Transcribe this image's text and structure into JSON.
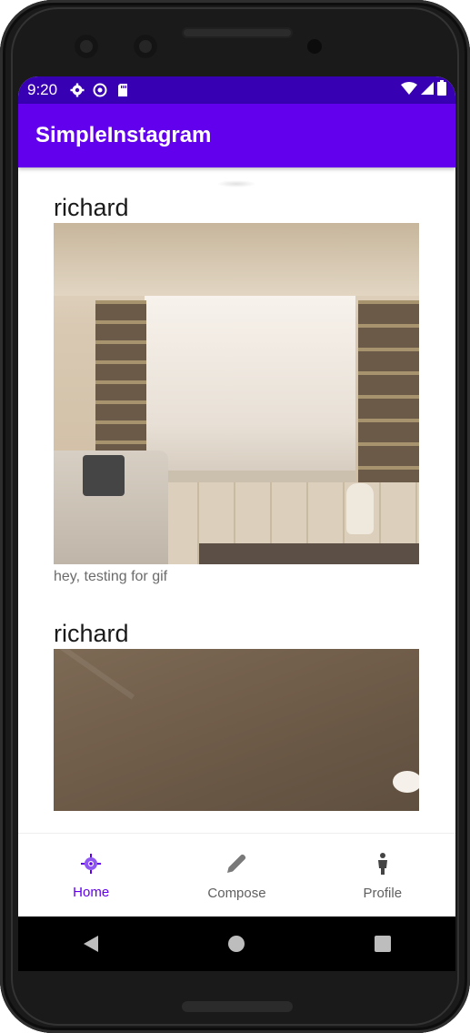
{
  "status_bar": {
    "time": "9:20",
    "icons": [
      "settings-gear-icon",
      "at-sign-icon",
      "sd-card-icon"
    ],
    "right_icons": [
      "wifi-icon",
      "signal-icon",
      "battery-icon"
    ]
  },
  "app_bar": {
    "title": "SimpleInstagram"
  },
  "posts": [
    {
      "username": "richard",
      "caption": "hey, testing for gif"
    },
    {
      "username": "richard",
      "caption": ""
    }
  ],
  "bottom_nav": {
    "items": [
      {
        "label": "Home",
        "icon": "home-target-icon",
        "active": true
      },
      {
        "label": "Compose",
        "icon": "pencil-icon",
        "active": false
      },
      {
        "label": "Profile",
        "icon": "person-icon",
        "active": false
      }
    ]
  },
  "system_nav": {
    "buttons": [
      "back-icon",
      "home-icon",
      "recents-icon"
    ]
  },
  "colors": {
    "status_bar": "#3700b3",
    "app_bar": "#6200ee",
    "nav_active": "#6200ee",
    "nav_inactive": "#5f5f5f"
  }
}
